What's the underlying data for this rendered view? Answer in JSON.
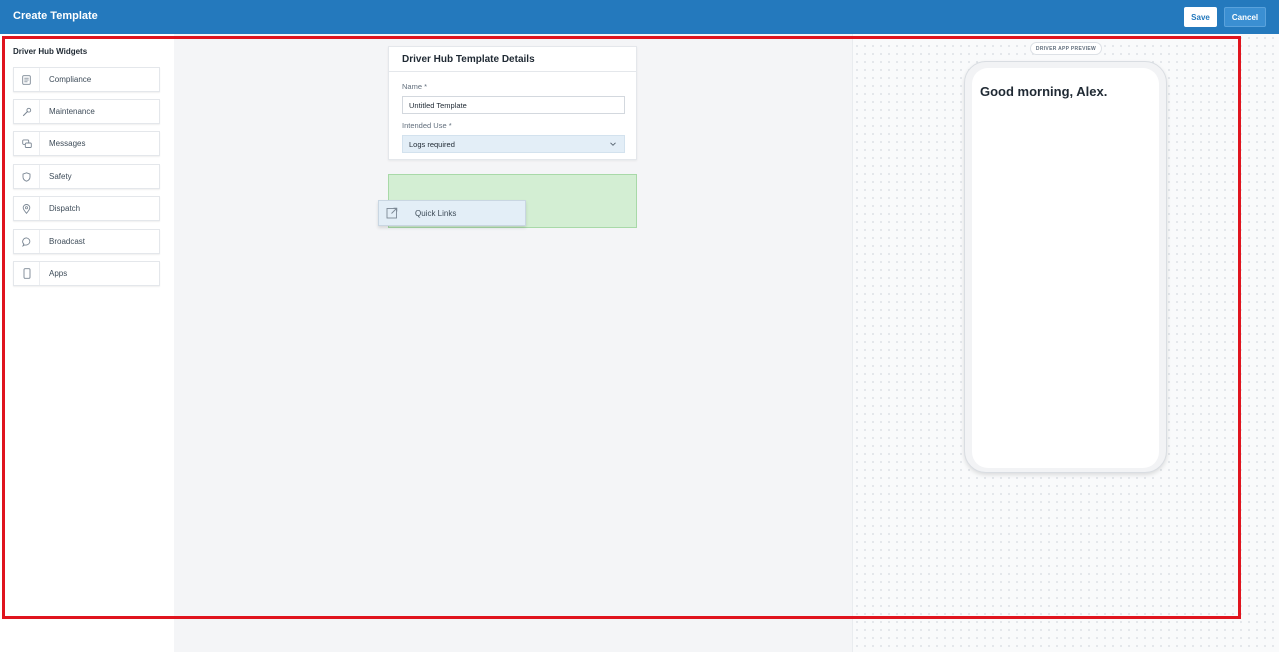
{
  "header": {
    "title": "Create Template",
    "save_label": "Save",
    "cancel_label": "Cancel",
    "brand_color": "#2479bd"
  },
  "sidebar": {
    "title": "Driver Hub Widgets",
    "items": [
      {
        "label": "Compliance",
        "icon": "document-icon"
      },
      {
        "label": "Maintenance",
        "icon": "wrench-icon"
      },
      {
        "label": "Messages",
        "icon": "chat-bubbles-icon"
      },
      {
        "label": "Safety",
        "icon": "shield-icon"
      },
      {
        "label": "Dispatch",
        "icon": "map-pin-icon"
      },
      {
        "label": "Broadcast",
        "icon": "speech-bubble-icon"
      },
      {
        "label": "Apps",
        "icon": "phone-icon"
      }
    ]
  },
  "details": {
    "title": "Driver Hub Template Details",
    "name_label": "Name *",
    "name_value": "Untitled Template",
    "intended_use_label": "Intended Use *",
    "intended_use_value": "Logs required"
  },
  "dragging": {
    "label": "Quick Links",
    "icon": "external-link-icon",
    "dropzone_color": "#d3eed3"
  },
  "preview": {
    "tag": "DRIVER APP PREVIEW",
    "greeting": "Good morning, Alex."
  }
}
